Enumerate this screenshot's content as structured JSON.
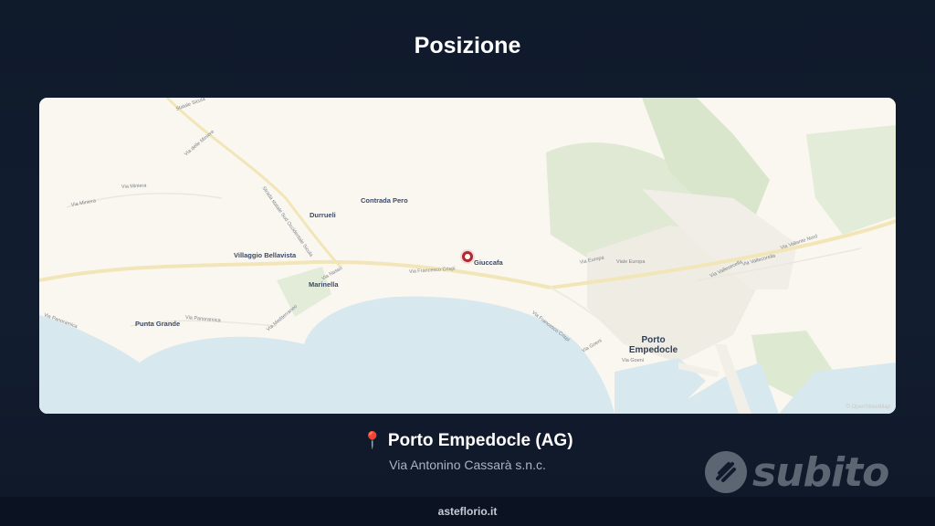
{
  "header": {
    "title": "Posizione"
  },
  "map": {
    "places": {
      "durrueli": "Durrueli",
      "contrada_pero": "Contrada Pero",
      "villaggio_bellavista": "Villaggio Bellavista",
      "marinella": "Marinella",
      "giuccafa": "Giuccafa",
      "punta_grande": "Punta Grande",
      "porto_empedocle": "Porto\nEmpedocle"
    },
    "roads": {
      "r1": "Via Miniera",
      "r2": "Via Miniera",
      "r3": "Via delle Miniere",
      "r4": "Strada statale Sud Occidentale Sicula",
      "r5": "Statale Sicula",
      "r6": "Via Francesco Crispi",
      "r7": "Via Europa",
      "r8": "Viale Europa",
      "r9": "Via Vallante Nord",
      "r10": "Via Francesco Crispi",
      "r11": "Via Goeni",
      "r12": "Via Goeni",
      "r13": "Via Panoramica",
      "r14": "Via Panoramica",
      "r15": "Via Mediterraneo",
      "r16": "Via Nasso",
      "r17": "Via Vallesecella",
      "r18": "Via Vallecorella"
    },
    "attribution": "© OpenStreetMap",
    "marker_label": "location-marker"
  },
  "location": {
    "pin_icon": "📍",
    "name": "Porto Empedocle (AG)",
    "address": "Via Antonino Cassarà s.n.c."
  },
  "brand": {
    "logo_text": "subito"
  },
  "footer": {
    "site": "asteflorio.it"
  },
  "colors": {
    "background": "#0f1a2b",
    "sea": "#d7e8ee",
    "land": "#faf7f0",
    "green": "#dbe8cf",
    "marker": "#b3262b",
    "road": "#f2e6b8"
  }
}
